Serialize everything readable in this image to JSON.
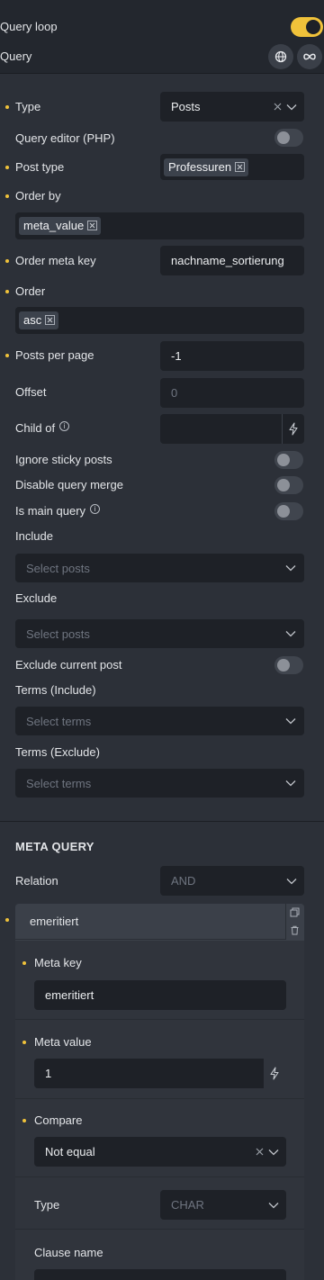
{
  "header": {
    "query_loop_label": "Query loop",
    "query_label": "Query",
    "globe_icon": "globe-icon",
    "infinity_icon": "infinity-icon",
    "accent": "#f0c23a"
  },
  "fields": {
    "type": {
      "label": "Type",
      "value": "Posts"
    },
    "query_editor": {
      "label": "Query editor (PHP)"
    },
    "post_type": {
      "label": "Post type",
      "tag": "Professuren"
    },
    "order_by": {
      "label": "Order by",
      "tag": "meta_value"
    },
    "order_meta_key": {
      "label": "Order meta key",
      "value": "nachname_sortierung"
    },
    "order": {
      "label": "Order",
      "tag": "asc"
    },
    "posts_per_page": {
      "label": "Posts per page",
      "value": "-1"
    },
    "offset": {
      "label": "Offset",
      "placeholder": "0"
    },
    "child_of": {
      "label": "Child of"
    },
    "ignore_sticky": {
      "label": "Ignore sticky posts"
    },
    "disable_merge": {
      "label": "Disable query merge"
    },
    "is_main": {
      "label": "Is main query"
    },
    "include": {
      "label": "Include",
      "placeholder": "Select posts"
    },
    "exclude": {
      "label": "Exclude",
      "placeholder": "Select posts"
    },
    "exclude_current": {
      "label": "Exclude current post"
    },
    "terms_include": {
      "label": "Terms (Include)",
      "placeholder": "Select terms"
    },
    "terms_exclude": {
      "label": "Terms (Exclude)",
      "placeholder": "Select terms"
    }
  },
  "meta_query": {
    "heading": "META QUERY",
    "relation": {
      "label": "Relation",
      "value": "AND"
    },
    "clause": {
      "title": "emeritiert",
      "meta_key": {
        "label": "Meta key",
        "value": "emeritiert"
      },
      "meta_value": {
        "label": "Meta value",
        "value": "1"
      },
      "compare": {
        "label": "Compare",
        "value": "Not equal"
      },
      "type": {
        "label": "Type",
        "value": "CHAR"
      },
      "clause_name": {
        "label": "Clause name"
      }
    }
  }
}
